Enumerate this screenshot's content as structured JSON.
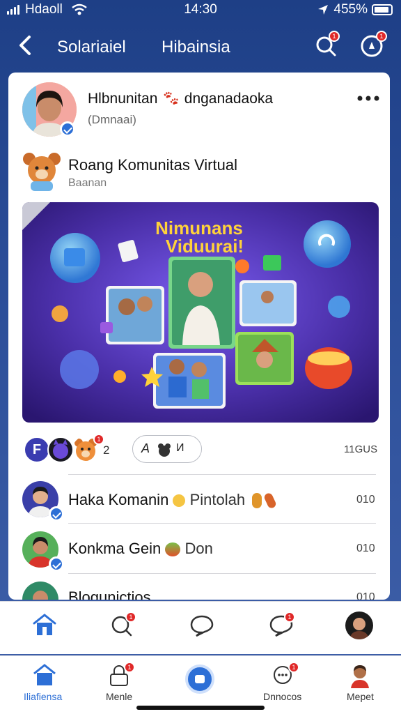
{
  "status_bar": {
    "carrier": "Hdaoll",
    "time": "14:30",
    "battery": "455%"
  },
  "nav": {
    "title_left": "Solariaiel",
    "title_center": "Hibainsia"
  },
  "post": {
    "author": "Hlbnunitan",
    "author_suffix": "dnganadaoka",
    "author_sub": "(Dmnaai)",
    "group_name": "Roang Komunitas Virtual",
    "group_sub": "Baanan",
    "banner_title_line1": "Nimunans",
    "banner_title_line2": "Viduurai!",
    "reaction_count": "2",
    "pill_label": "И",
    "pill_letter": "A",
    "views": "11GUS"
  },
  "reaction_avatars": [
    {
      "label": "F"
    }
  ],
  "list": [
    {
      "name": "Haka Komanin",
      "extra": "Pintolah",
      "value": "010"
    },
    {
      "name": "Konkma Gein",
      "extra": "Don",
      "value": "010"
    },
    {
      "name": "Blogunictios",
      "extra": "",
      "value": "010"
    }
  ],
  "bottom_nav": [
    {
      "label": "Iliafiensa",
      "active": true
    },
    {
      "label": "Menle",
      "active": false
    },
    {
      "label": "",
      "active": false
    },
    {
      "label": "Dnnocos",
      "active": false
    },
    {
      "label": "Mepet",
      "active": false
    }
  ],
  "colors": {
    "primary": "#1e3f86",
    "accent": "#2d6fd6",
    "badge": "#e02828",
    "banner_bg": "#4a2fa8"
  },
  "icons": [
    "back-arrow-icon",
    "search-icon",
    "notification-icon",
    "more-icon",
    "home-icon",
    "search-icon",
    "chat-icon",
    "messages-icon",
    "profile-icon"
  ]
}
